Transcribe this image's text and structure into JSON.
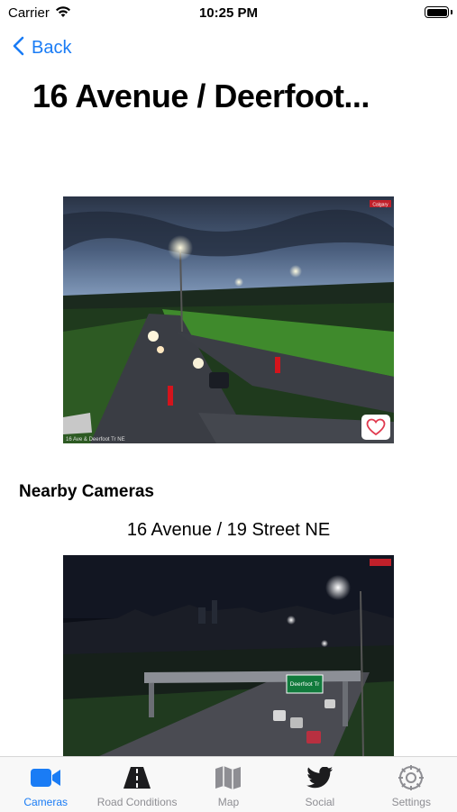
{
  "status_bar": {
    "carrier": "Carrier",
    "time": "10:25 PM"
  },
  "nav": {
    "back_label": "Back"
  },
  "page_title": "16 Avenue / Deerfoot...",
  "main_camera": {
    "overlay_caption": "16 Ave & Deerfoot Tr NE",
    "watermark": "Calgary",
    "favorite_icon": "heart-icon"
  },
  "nearby": {
    "heading": "Nearby Cameras",
    "cameras": [
      {
        "title": "16 Avenue / 19 Street NE",
        "sign_text": "Deerfoot Tr"
      }
    ]
  },
  "tab_bar": {
    "active": "cameras",
    "tabs": [
      {
        "key": "cameras",
        "label": "Cameras",
        "icon": "video-camera-icon"
      },
      {
        "key": "road_conditions",
        "label": "Road Conditions",
        "icon": "road-icon"
      },
      {
        "key": "map",
        "label": "Map",
        "icon": "map-icon"
      },
      {
        "key": "social",
        "label": "Social",
        "icon": "twitter-bird-icon"
      },
      {
        "key": "settings",
        "label": "Settings",
        "icon": "gear-icon"
      }
    ]
  },
  "colors": {
    "accent": "#1a7cf5",
    "tab_inactive": "#8e8e93"
  }
}
